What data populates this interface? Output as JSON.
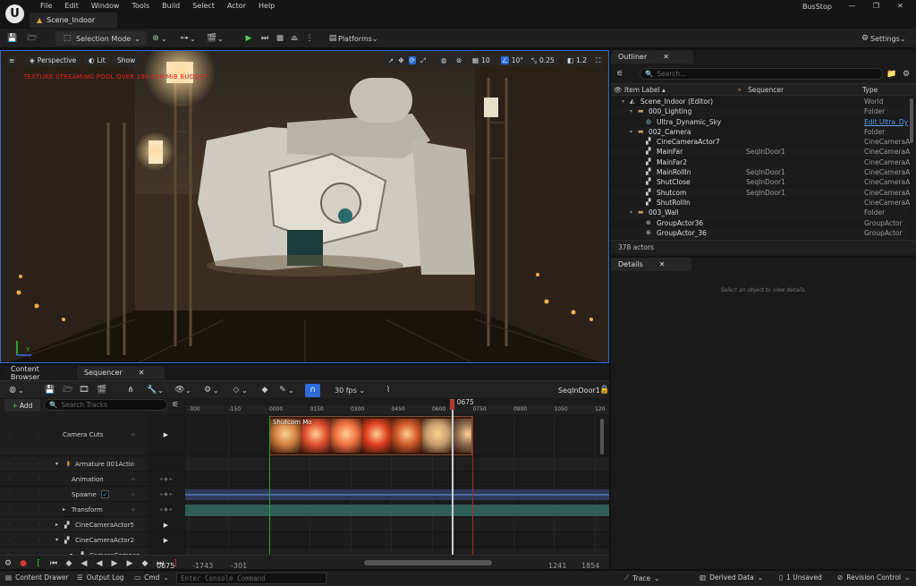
{
  "app": {
    "logo_glyph": "U",
    "project": "BusStop",
    "level_tab": "Scene_Indoor"
  },
  "menu": [
    "File",
    "Edit",
    "Window",
    "Tools",
    "Build",
    "Select",
    "Actor",
    "Help"
  ],
  "window_controls": [
    "—",
    "❐",
    "✕"
  ],
  "toolbar": {
    "mode": "Selection Mode",
    "platforms": "Platforms",
    "settings": "Settings"
  },
  "viewport": {
    "perspective": "Perspective",
    "lit": "Lit",
    "show": "Show",
    "grid_value": "10",
    "angle_value": "10°",
    "scale_value": "0.25",
    "cam_speed": "1.2",
    "warning": "TEXTURE STREAMING POOL OVER 190.828 MiB BUDGET"
  },
  "outliner": {
    "tab": "Outliner",
    "search_placeholder": "Search...",
    "columns": {
      "label": "Item Label ▴",
      "sequencer": "Sequencer",
      "type": "Type"
    },
    "rows": [
      {
        "label": "Scene_Indoor (Editor)",
        "seq": "",
        "type": "World",
        "indent": 1,
        "icon": "world"
      },
      {
        "label": "000_Lighting",
        "seq": "",
        "type": "Folder",
        "indent": 2,
        "icon": "folder"
      },
      {
        "label": "Ultra_Dynamic_Sky",
        "seq": "",
        "type": "Edit Ultra_Dy",
        "indent": 3,
        "icon": "actor",
        "link": true
      },
      {
        "label": "002_Camera",
        "seq": "",
        "type": "Folder",
        "indent": 2,
        "icon": "folder"
      },
      {
        "label": "CineCameraActor7",
        "seq": "",
        "type": "CineCameraA",
        "indent": 3,
        "icon": "camera"
      },
      {
        "label": "MainFar",
        "seq": "SeqInDoor1",
        "type": "CineCameraA",
        "indent": 3,
        "icon": "camera"
      },
      {
        "label": "MainFar2",
        "seq": "",
        "type": "CineCameraA",
        "indent": 3,
        "icon": "camera"
      },
      {
        "label": "MainRollIn",
        "seq": "SeqInDoor1",
        "type": "CineCameraA",
        "indent": 3,
        "icon": "camera"
      },
      {
        "label": "ShutClose",
        "seq": "SeqInDoor1",
        "type": "CineCameraA",
        "indent": 3,
        "icon": "camera"
      },
      {
        "label": "Shutcom",
        "seq": "SeqInDoor1",
        "type": "CineCameraA",
        "indent": 3,
        "icon": "camera"
      },
      {
        "label": "ShutRollIn",
        "seq": "",
        "type": "CineCameraA",
        "indent": 3,
        "icon": "camera"
      },
      {
        "label": "003_Wall",
        "seq": "",
        "type": "Folder",
        "indent": 2,
        "icon": "folder"
      },
      {
        "label": "GroupActor36",
        "seq": "",
        "type": "GroupActor",
        "indent": 3,
        "icon": "group"
      },
      {
        "label": "GroupActor_36",
        "seq": "",
        "type": "GroupActor",
        "indent": 3,
        "icon": "group"
      }
    ],
    "count": "378 actors"
  },
  "details": {
    "tab": "Details",
    "empty": "Select an object to view details."
  },
  "bottom_tabs": [
    "Content Browser",
    "Sequencer"
  ],
  "sequencer": {
    "fps": "30 fps",
    "sequence_name": "SeqInDoor1",
    "add_label": "Add",
    "search_placeholder": "Search Tracks",
    "playhead_frame": "0675",
    "ruler_ticks": [
      "-300",
      "-150",
      "0000",
      "0150",
      "0300",
      "0450",
      "0600",
      "0750",
      "0900",
      "1050",
      "120"
    ],
    "shot_label": "Shutcom Mo",
    "tracks": [
      {
        "name": "Camera Cuts",
        "right": "camera"
      },
      {
        "name": "Armature 001Actio",
        "right": ""
      },
      {
        "name": "Animation",
        "right": ""
      },
      {
        "name": "Spawne",
        "right": ""
      },
      {
        "name": "Transform",
        "right": ""
      },
      {
        "name": "CineCameraActor5",
        "right": "camera"
      },
      {
        "name": "CineCameraActor2",
        "right": "camera"
      },
      {
        "name": "CameraCompon",
        "right": ""
      }
    ],
    "status": {
      "current_frame": "0675",
      "view_start": "-1743",
      "work_start": "-301",
      "work_end": "1241",
      "view_end": "1854"
    }
  },
  "statusbar": {
    "content_drawer": "Content Drawer",
    "output_log": "Output Log",
    "cmd": "Cmd",
    "console_placeholder": "Enter Console Command",
    "trace": "Trace",
    "derived_data": "Derived Data",
    "unsaved": "1 Unsaved",
    "revision": "Revision Control"
  },
  "colors": {
    "accent": "#2c6bd8",
    "playhead": "#b33b2c",
    "warning": "#e62020"
  }
}
